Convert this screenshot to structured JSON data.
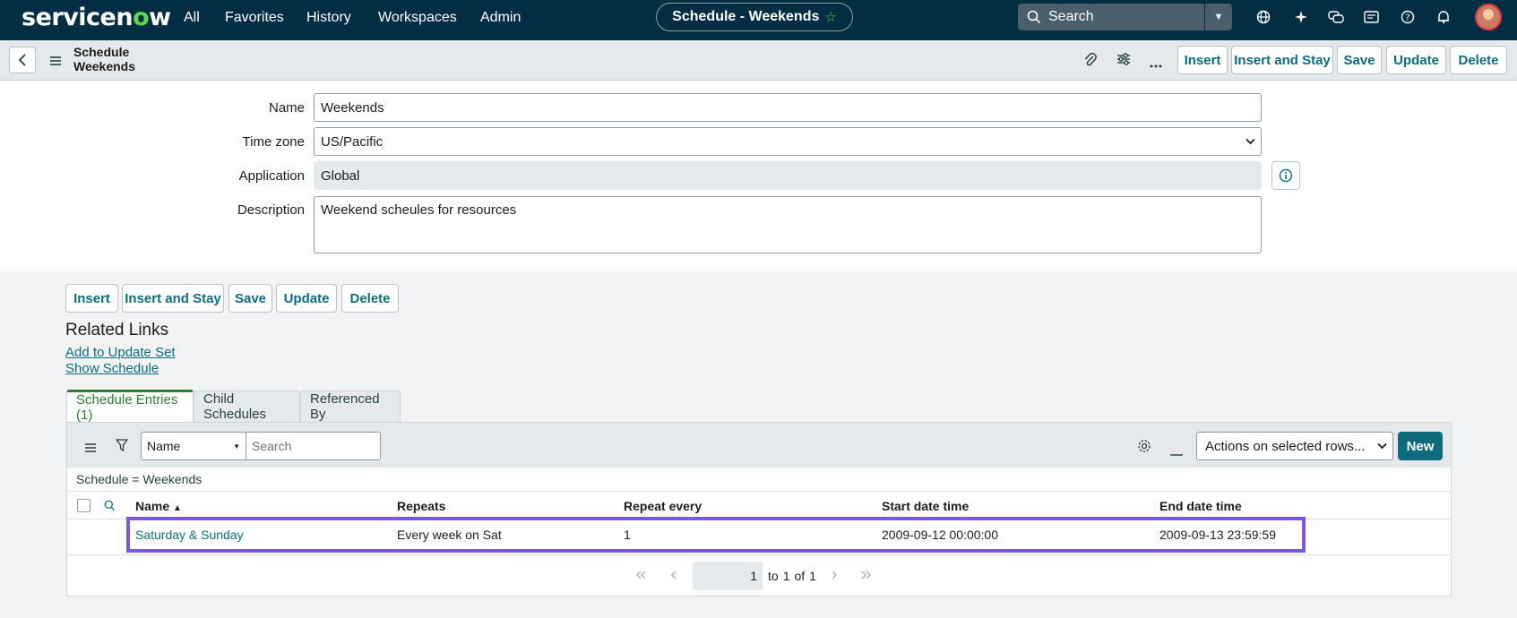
{
  "topnav": {
    "logo_a": "servicen",
    "logo_o": "o",
    "logo_b": "w",
    "links": [
      "All",
      "Favorites",
      "History",
      "Workspaces",
      "Admin"
    ],
    "context_title": "Schedule - Weekends",
    "search_placeholder": "Search",
    "icons": [
      "globe-icon",
      "sparkle-icon",
      "chat-icon",
      "inbox-icon",
      "help-icon",
      "bell-icon"
    ]
  },
  "form_header": {
    "title_line1": "Schedule",
    "title_line2": "Weekends",
    "buttons": [
      "Insert",
      "Insert and Stay",
      "Save",
      "Update",
      "Delete"
    ]
  },
  "form": {
    "name_label": "Name",
    "name_value": "Weekends",
    "timezone_label": "Time zone",
    "timezone_value": "US/Pacific",
    "application_label": "Application",
    "application_value": "Global",
    "description_label": "Description",
    "description_value": "Weekend scheules for resources"
  },
  "bottom_buttons": [
    "Insert",
    "Insert and Stay",
    "Save",
    "Update",
    "Delete"
  ],
  "related_links": {
    "title": "Related Links",
    "links": [
      "Add to Update Set",
      "Show Schedule"
    ]
  },
  "tabs": [
    "Schedule Entries (1)",
    "Child Schedules",
    "Referenced By"
  ],
  "list": {
    "field_select": "Name",
    "search_placeholder": "Search",
    "actions_select": "Actions on selected rows...",
    "new_label": "New",
    "breadcrumb": "Schedule = Weekends",
    "columns": [
      "Name",
      "Repeats",
      "Repeat every",
      "Start date time",
      "End date time"
    ],
    "sort_indicator": "▲",
    "rows": [
      [
        "Saturday & Sunday",
        "Every week on Sat",
        "1",
        "2009-09-12 00:00:00",
        "2009-09-13 23:59:59"
      ]
    ],
    "pager": {
      "current": "1",
      "to": "to",
      "last": "1",
      "of": "of",
      "total": "1"
    }
  },
  "colors": {
    "nav_bg": "#032d42",
    "accent": "#0d6b7c",
    "brand_green": "#62d84e",
    "tab_active": "#2e7d32",
    "highlight": "#7b56e3"
  }
}
